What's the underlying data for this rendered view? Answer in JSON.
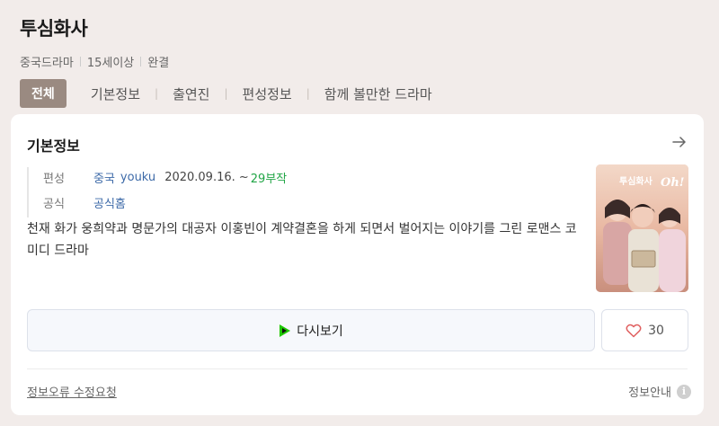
{
  "title": "투심화사",
  "meta": [
    "중국드라마",
    "15세이상",
    "완결"
  ],
  "tabs": [
    {
      "label": "전체",
      "active": true
    },
    {
      "label": "기본정보",
      "active": false
    },
    {
      "label": "출연진",
      "active": false
    },
    {
      "label": "편성정보",
      "active": false
    },
    {
      "label": "함께 볼만한 드라마",
      "active": false
    }
  ],
  "card": {
    "title": "기본정보",
    "broadcast_label": "편성",
    "broadcast_country": "중국",
    "broadcast_channel": "youku",
    "broadcast_date": "2020.09.16. ~",
    "episodes": "29부작",
    "official_label": "공식",
    "official_link": "공식홈",
    "description": "천재 화가 웅희약과 명문가의 대공자 이홍빈이 계약결혼을 하게 되면서 벌어지는 이야기를 그린 로맨스 코미디 드라마",
    "poster_title_text": "투심화사",
    "poster_logo_text": "Oh!",
    "rewatch_label": "다시보기",
    "like_count": "30",
    "report_label": "정보오류 수정요청",
    "guide_label": "정보안내"
  },
  "colors": {
    "background": "#f2ecea",
    "active_tab": "#9a8a81",
    "link": "#3d6aa8",
    "episodes": "#21a546",
    "heart": "#e06060"
  },
  "icons": [
    "arrow-right-icon",
    "play-icon",
    "heart-icon",
    "info-icon"
  ]
}
